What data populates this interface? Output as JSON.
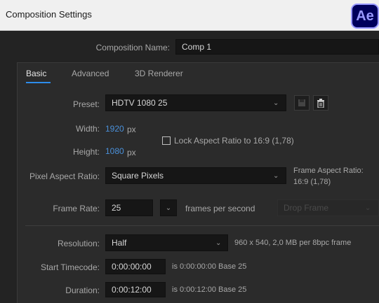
{
  "window": {
    "title": "Composition Settings"
  },
  "app_logo": {
    "text": "Ae"
  },
  "comp_name": {
    "label": "Composition Name:",
    "value": "Comp 1"
  },
  "tabs": [
    {
      "label": "Basic",
      "active": true
    },
    {
      "label": "Advanced",
      "active": false
    },
    {
      "label": "3D Renderer",
      "active": false
    }
  ],
  "preset": {
    "label": "Preset:",
    "value": "HDTV 1080 25"
  },
  "width": {
    "label": "Width:",
    "value": "1920",
    "unit": "px"
  },
  "height": {
    "label": "Height:",
    "value": "1080",
    "unit": "px"
  },
  "lock_aspect": {
    "label": "Lock Aspect Ratio to 16:9 (1,78)",
    "checked": false
  },
  "pixel_aspect": {
    "label": "Pixel Aspect Ratio:",
    "value": "Square Pixels"
  },
  "frame_aspect": {
    "label": "Frame Aspect Ratio:",
    "value": "16:9 (1,78)"
  },
  "frame_rate": {
    "label": "Frame Rate:",
    "value": "25",
    "unit": "frames per second",
    "drop_frame": "Drop Frame"
  },
  "resolution": {
    "label": "Resolution:",
    "value": "Half",
    "info": "960 x 540, 2,0 MB per 8bpc frame"
  },
  "start_timecode": {
    "label": "Start Timecode:",
    "value": "0:00:00:00",
    "info": "is 0:00:00:00  Base 25"
  },
  "duration": {
    "label": "Duration:",
    "value": "0:00:12:00",
    "info": "is 0:00:12:00  Base 25"
  },
  "colors": {
    "accent": "#2d8ceb",
    "blue_value": "#4a90d9",
    "logo_bg": "#00005b",
    "logo_fg": "#9999ff"
  }
}
